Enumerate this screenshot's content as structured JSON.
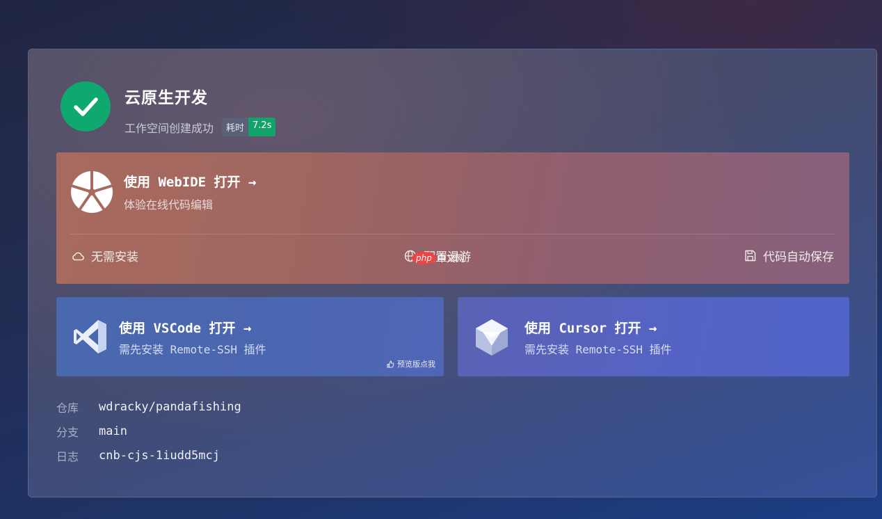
{
  "header": {
    "title": "云原生开发",
    "subtitle": "工作空间创建成功",
    "time_label": "耗时",
    "time_value": "7.2s"
  },
  "webide": {
    "title": "使用 WebIDE 打开 →",
    "description": "体验在线代码编辑",
    "features": [
      "无需安装",
      "配置漫游",
      "代码自动保存"
    ]
  },
  "vscode": {
    "title": "使用 VSCode 打开 →",
    "description": "需先安装 Remote-SSH 插件",
    "feedback": "预览版点我"
  },
  "cursor": {
    "title": "使用 Cursor 打开 →",
    "description": "需先安装 Remote-SSH 插件"
  },
  "info": [
    {
      "key": "仓库",
      "value": "wdracky/pandafishing"
    },
    {
      "key": "分支",
      "value": "main"
    },
    {
      "key": "日志",
      "value": "cnb-cjs-1iudd5mcj"
    }
  ],
  "watermark": {
    "brand": "php",
    "text": "中文网"
  },
  "colors": {
    "success": "#0fa86e",
    "badge_value": "#13a36a"
  },
  "icons": {
    "status": "check-icon",
    "webide": "webide-logo-icon",
    "cloud": "cloud-icon",
    "globe": "globe-icon",
    "save": "save-icon",
    "vscode": "vscode-logo-icon",
    "cursor": "cursor-logo-icon",
    "feedback": "hand-icon"
  }
}
